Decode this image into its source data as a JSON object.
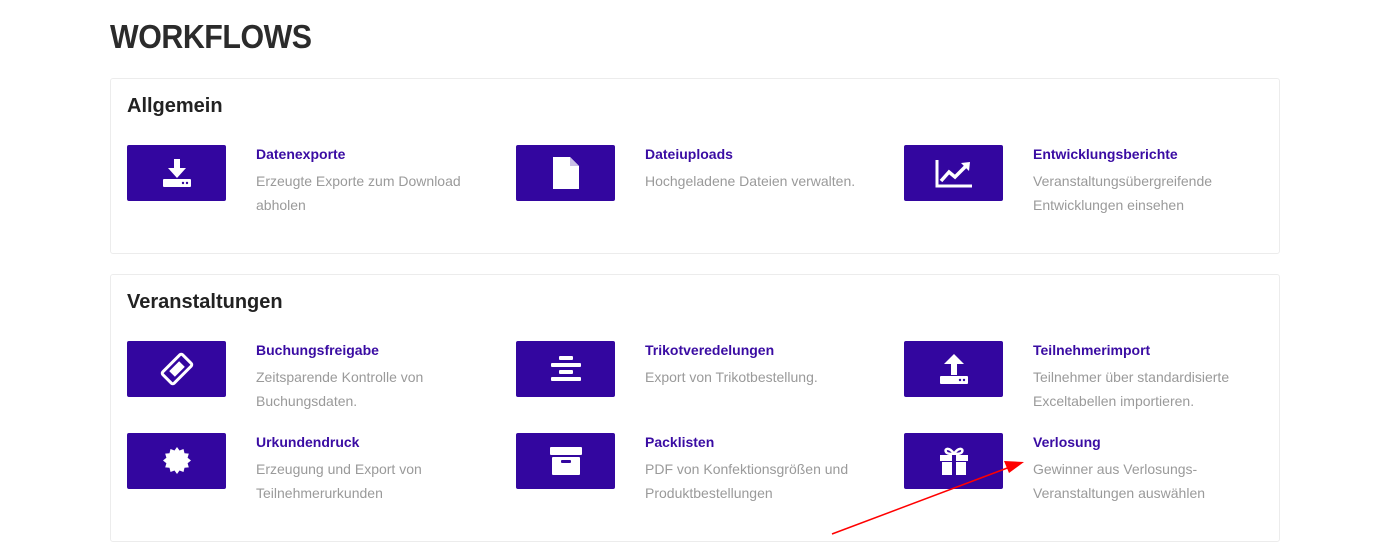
{
  "page": {
    "title": "WORKFLOWS"
  },
  "sections": [
    {
      "heading": "Allgemein",
      "tiles": [
        {
          "title": "Datenexporte",
          "desc": "Erzeugte Exporte zum Download abholen",
          "icon": "download-icon"
        },
        {
          "title": "Dateiuploads",
          "desc": "Hochgeladene Dateien verwalten.",
          "icon": "file-icon"
        },
        {
          "title": "Entwicklungsberichte",
          "desc": "Veranstaltungsübergreifende Entwicklungen einsehen",
          "icon": "line-chart-icon"
        }
      ]
    },
    {
      "heading": "Veranstaltungen",
      "tiles": [
        {
          "title": "Buchungsfreigabe",
          "desc": "Zeitsparende Kontrolle von Buchungsdaten.",
          "icon": "ticket-icon"
        },
        {
          "title": "Trikotveredelungen",
          "desc": "Export von Trikotbestellung.",
          "icon": "align-center-icon"
        },
        {
          "title": "Teilnehmerimport",
          "desc": "Teilnehmer über standardisierte Exceltabellen importieren.",
          "icon": "upload-icon"
        },
        {
          "title": "Urkundendruck",
          "desc": "Erzeugung und Export von Teilnehmerurkunden",
          "icon": "certificate-icon"
        },
        {
          "title": "Packlisten",
          "desc": "PDF von Konfektionsgrößen und Produktbestellungen",
          "icon": "archive-icon"
        },
        {
          "title": "Verlosung",
          "desc": "Gewinner aus Verlosungs-Veranstaltungen auswählen",
          "icon": "gift-icon"
        }
      ]
    }
  ],
  "colors": {
    "accent": "#33069f",
    "title_link": "#3a0ca3",
    "muted_text": "#9a9a9a",
    "annotation_arrow": "#ff0000"
  }
}
